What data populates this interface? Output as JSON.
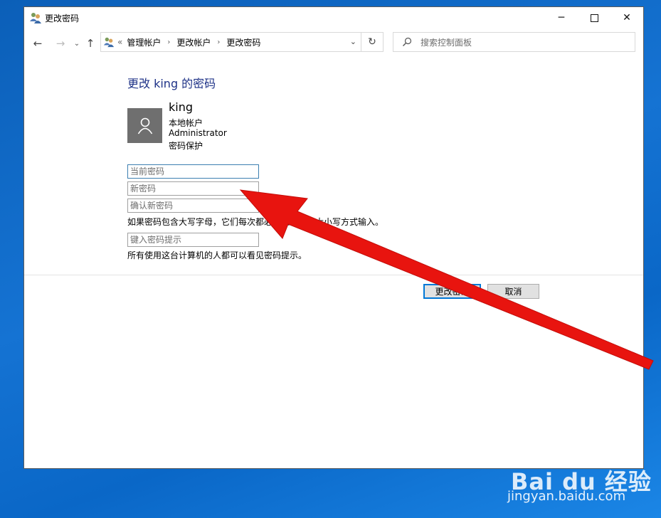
{
  "window": {
    "title": "更改密码"
  },
  "window_controls": {
    "minimize": "─",
    "close": "✕"
  },
  "nav": {
    "back": "←",
    "forward": "→",
    "recent": "⌄",
    "up": "↑",
    "address_prefix": "«",
    "breadcrumbs": [
      "管理帐户",
      "更改帐户",
      "更改密码"
    ],
    "crumb_sep": "›",
    "dropdown": "⌄",
    "refresh": "↻",
    "search_placeholder": "搜索控制面板"
  },
  "main": {
    "title": "更改 king 的密码",
    "user": {
      "name": "king",
      "lines": [
        "本地帐户",
        "Administrator",
        "密码保护"
      ]
    },
    "fields": {
      "current_password": "当前密码",
      "new_password": "新密码",
      "confirm_password": "确认新密码",
      "password_hint": "键入密码提示"
    },
    "case_note": "如果密码包含大写字母，它们每次都必须以相同的大小写方式输入。",
    "hint_note": "所有使用这台计算机的人都可以看见密码提示。"
  },
  "buttons": {
    "change": "更改密码",
    "cancel": "取消"
  },
  "watermark": {
    "brand": "Bai du 经验",
    "url": "jingyan.baidu.com"
  },
  "colors": {
    "accent": "#0078d7",
    "title_blue": "#1e3287",
    "arrow_red": "#e8140f",
    "desktop_blue": "#1573d3"
  },
  "icons": [
    "users-icon",
    "back-arrow-icon",
    "forward-arrow-icon",
    "chevron-down-icon",
    "up-arrow-icon",
    "refresh-icon",
    "search-icon",
    "user-avatar-icon"
  ]
}
